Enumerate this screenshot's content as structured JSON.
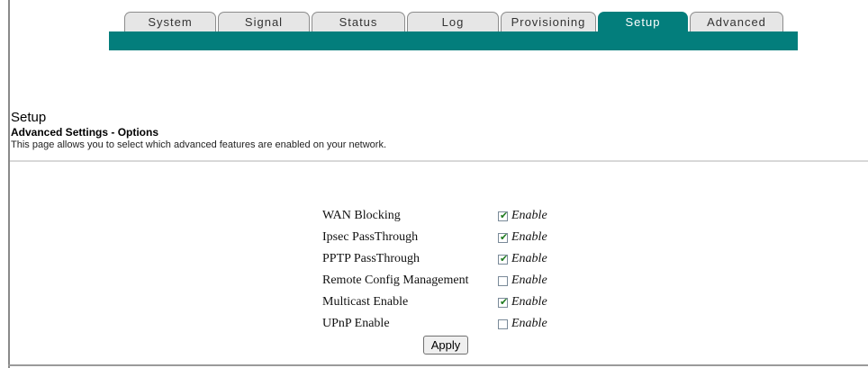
{
  "nav": {
    "tabs": [
      {
        "label": "System"
      },
      {
        "label": "Signal"
      },
      {
        "label": "Status"
      },
      {
        "label": "Log"
      },
      {
        "label": "Provisioning"
      },
      {
        "label": "Setup"
      },
      {
        "label": "Advanced"
      }
    ],
    "active_tab": "Setup",
    "accent_color": "#037e7c"
  },
  "page": {
    "title": "Setup",
    "subtitle": "Advanced Settings - Options",
    "description": "This page allows you to select which advanced features are enabled on your network."
  },
  "options": [
    {
      "label": "WAN Blocking",
      "enable_label": "Enable",
      "checked": true
    },
    {
      "label": "Ipsec PassThrough",
      "enable_label": "Enable",
      "checked": true
    },
    {
      "label": "PPTP PassThrough",
      "enable_label": "Enable",
      "checked": true
    },
    {
      "label": "Remote Config Management",
      "enable_label": "Enable",
      "checked": false
    },
    {
      "label": "Multicast Enable",
      "enable_label": "Enable",
      "checked": true
    },
    {
      "label": "UPnP Enable",
      "enable_label": "Enable",
      "checked": false
    }
  ],
  "apply_label": "Apply"
}
